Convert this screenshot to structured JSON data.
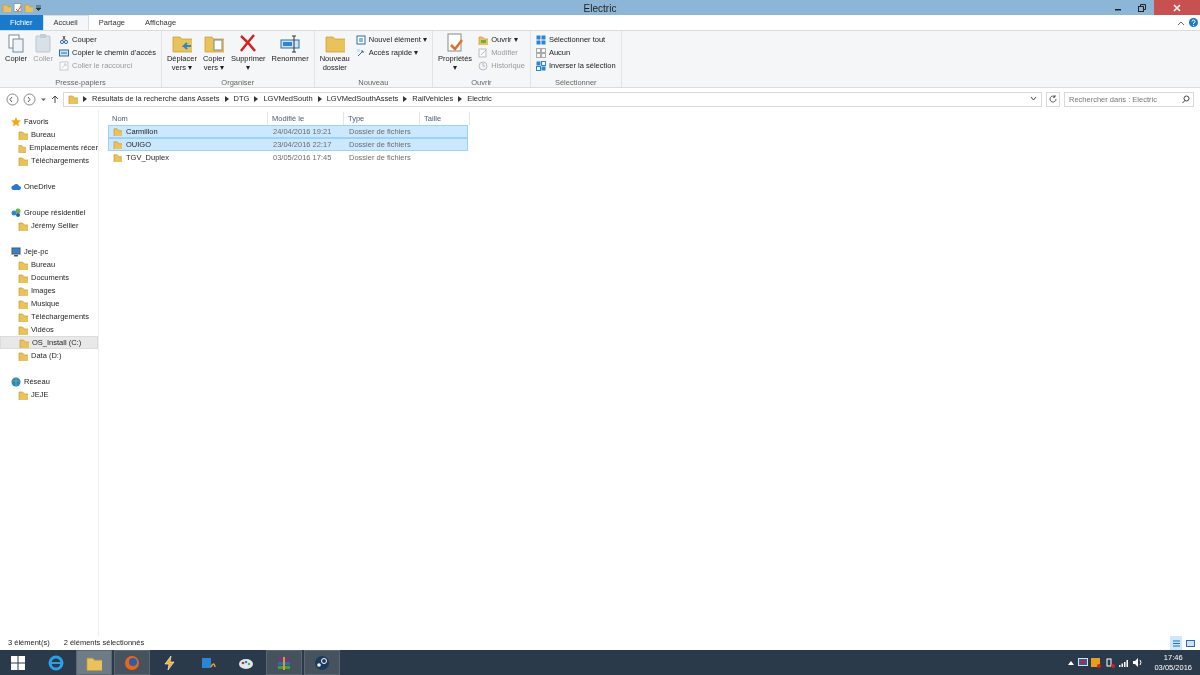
{
  "window": {
    "title": "Electric"
  },
  "ribbon": {
    "tabs": [
      {
        "label": "Fichier",
        "kind": "file",
        "selected": false
      },
      {
        "label": "Accueil",
        "kind": "tab",
        "selected": true
      },
      {
        "label": "Partage",
        "kind": "tab",
        "selected": false
      },
      {
        "label": "Affichage",
        "kind": "tab",
        "selected": false
      }
    ],
    "groups": [
      {
        "label": "Presse-papiers",
        "items": [
          {
            "label": "Copier",
            "kind": "large",
            "disabled": false
          },
          {
            "label": "Coller",
            "kind": "large",
            "disabled": true
          },
          {
            "kind": "stack",
            "items": [
              {
                "label": "Couper",
                "disabled": false
              },
              {
                "label": "Copier le chemin d’accès",
                "disabled": false
              },
              {
                "label": "Coller le raccourci",
                "disabled": true
              }
            ]
          }
        ]
      },
      {
        "label": "Organiser",
        "items": [
          {
            "label": "Déplacer\nvers ▾",
            "kind": "large",
            "disabled": false
          },
          {
            "label": "Copier\nvers ▾",
            "kind": "large",
            "disabled": false
          },
          {
            "label": "Supprimer\n▾",
            "kind": "large",
            "disabled": false
          },
          {
            "label": "Renommer",
            "kind": "large",
            "disabled": false
          }
        ]
      },
      {
        "label": "Nouveau",
        "items": [
          {
            "label": "Nouveau\ndossier",
            "kind": "large",
            "disabled": false
          },
          {
            "kind": "stack",
            "items": [
              {
                "label": "Nouvel élément ▾",
                "disabled": false
              },
              {
                "label": "Accès rapide ▾",
                "disabled": false
              }
            ]
          }
        ]
      },
      {
        "label": "Ouvrir",
        "items": [
          {
            "label": "Propriétés\n▾",
            "kind": "large",
            "disabled": false
          },
          {
            "kind": "stack",
            "items": [
              {
                "label": "Ouvrir ▾",
                "disabled": false
              },
              {
                "label": "Modifier",
                "disabled": true
              },
              {
                "label": "Historique",
                "disabled": true
              }
            ]
          }
        ]
      },
      {
        "label": "Sélectionner",
        "items": [
          {
            "kind": "stack",
            "items": [
              {
                "label": "Sélectionner tout",
                "disabled": false
              },
              {
                "label": "Aucun",
                "disabled": false
              },
              {
                "label": "Inverser la sélection",
                "disabled": false
              }
            ]
          }
        ]
      }
    ]
  },
  "address": {
    "crumbs": [
      "Résultats de la recherche dans Assets",
      "DTG",
      "LGVMedSouth",
      "LGVMedSouthAssets",
      "RailVehicles",
      "Electric"
    ],
    "search": {
      "placeholder": "Rechercher dans : Electric"
    }
  },
  "sidebar": {
    "sections": [
      {
        "label": "Favoris",
        "children": [
          {
            "label": "Bureau",
            "selected": false
          },
          {
            "label": "Emplacements récer",
            "selected": false
          },
          {
            "label": "Téléchargements",
            "selected": false
          }
        ]
      },
      {
        "label": "OneDrive"
      },
      {
        "label": "Groupe résidentiel",
        "children": [
          {
            "label": "Jérémy Sellier",
            "selected": false
          }
        ]
      },
      {
        "label": "Jeje-pc",
        "children": [
          {
            "label": "Bureau",
            "selected": false
          },
          {
            "label": "Documents",
            "selected": false
          },
          {
            "label": "Images",
            "selected": false
          },
          {
            "label": "Musique",
            "selected": false
          },
          {
            "label": "Téléchargements",
            "selected": false
          },
          {
            "label": "Vidéos",
            "selected": false
          },
          {
            "label": "OS_Install (C:)",
            "selected": true
          },
          {
            "label": "Data (D:)",
            "selected": false
          }
        ]
      },
      {
        "label": "Réseau",
        "children": [
          {
            "label": "JEJE",
            "selected": false
          }
        ]
      }
    ]
  },
  "table": {
    "columns": [
      "Nom",
      "Modifié le",
      "Type",
      "Taille"
    ],
    "rows": [
      {
        "cells": [
          "Carmillon",
          "24/04/2016 19:21",
          "Dossier de fichiers"
        ],
        "selected": true
      },
      {
        "cells": [
          "OUIGO",
          "23/04/2016 22:17",
          "Dossier de fichiers"
        ],
        "selected": true
      },
      {
        "cells": [
          "TGV_Duplex",
          "03/05/2016 17:45",
          "Dossier de fichiers"
        ],
        "selected": false
      }
    ]
  },
  "status_bar": [
    "3 élément(s)",
    "2 éléments sélectionnés"
  ],
  "taskbar": {
    "apps": [
      {
        "running": false
      },
      {
        "running": true,
        "selected": true
      },
      {
        "running": true,
        "selected": false
      },
      {
        "running": false
      },
      {
        "running": false
      },
      {
        "running": false
      },
      {
        "running": true,
        "selected": false
      },
      {
        "running": true,
        "selected": false
      }
    ],
    "clock": {
      "time": "17:46",
      "date": "03/05/2016"
    }
  }
}
